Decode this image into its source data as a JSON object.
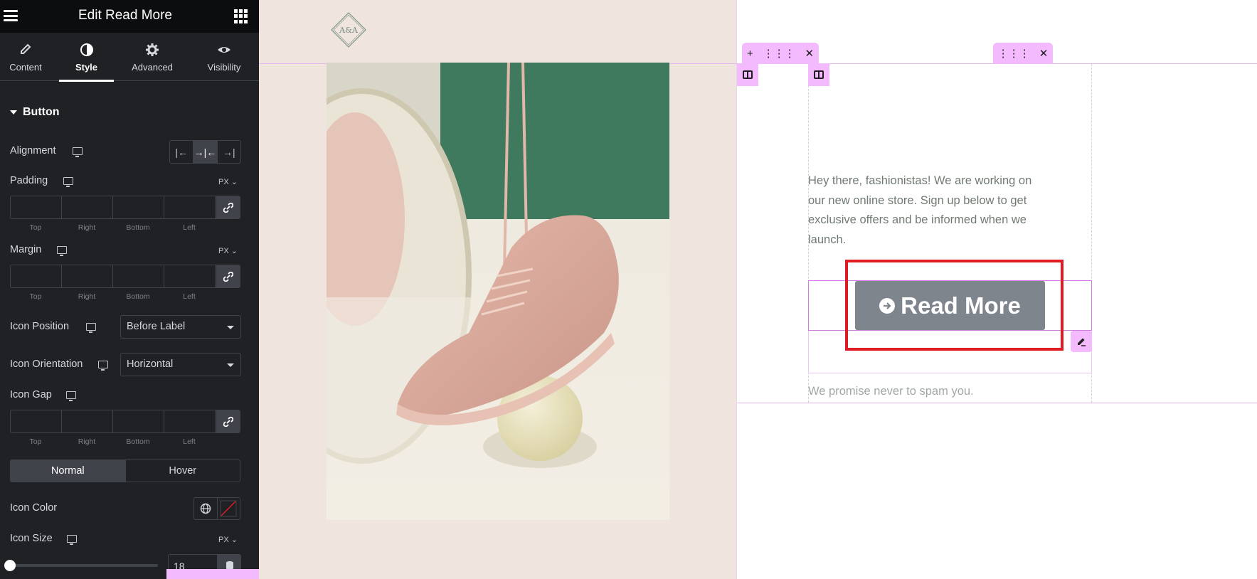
{
  "panel": {
    "title": "Edit Read More",
    "tabs": [
      {
        "label": "Content",
        "icon": "pencil-icon"
      },
      {
        "label": "Style",
        "icon": "half-circle-icon"
      },
      {
        "label": "Advanced",
        "icon": "gear-icon"
      },
      {
        "label": "Visibility",
        "icon": "eye-icon"
      }
    ],
    "active_tab": "Style",
    "section": "Button",
    "controls": {
      "alignment": "Alignment",
      "padding": "Padding",
      "margin": "Margin",
      "icon_position": "Icon Position",
      "icon_position_value": "Before Label",
      "icon_orientation": "Icon Orientation",
      "icon_orientation_value": "Horizontal",
      "icon_gap": "Icon Gap",
      "icon_color": "Icon Color",
      "icon_size": "Icon Size",
      "icon_size_value": "18",
      "unit": "PX",
      "dim_labels": [
        "Top",
        "Right",
        "Bottom",
        "Left"
      ],
      "state_normal": "Normal",
      "state_hover": "Hover"
    }
  },
  "canvas": {
    "logo_text": "A&A",
    "intro_text": "Hey there, fashionistas! We are working on our new online store. Sign up below to get exclusive offers and be informed when we launch.",
    "button_label": "Read More",
    "promise_text": "We promise never to spam you.",
    "colors": {
      "panel_bg": "#1f2124",
      "canvas_beige": "#f0e4de",
      "handle_pink": "#f3bafd",
      "button_gray": "#7e858c",
      "highlight_red": "#e01b24"
    }
  }
}
